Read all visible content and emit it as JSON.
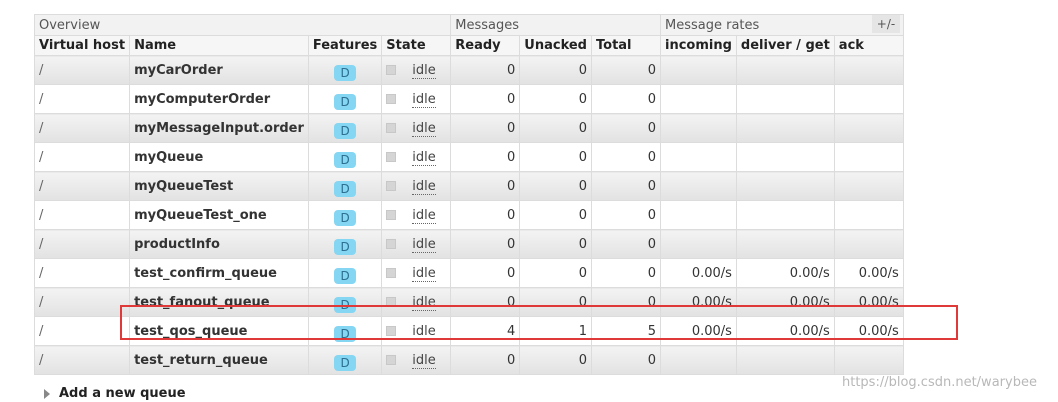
{
  "table": {
    "group_headers": {
      "overview": "Overview",
      "messages": "Messages",
      "message_rates": "Message rates"
    },
    "columns": [
      "Virtual host",
      "Name",
      "Features",
      "State",
      "Ready",
      "Unacked",
      "Total",
      "incoming",
      "deliver / get",
      "ack"
    ],
    "plus_minus": "+/-",
    "rows": [
      {
        "vhost": "/",
        "name": "myCarOrder",
        "feature": "D",
        "state": "idle",
        "ready": "0",
        "unacked": "0",
        "total": "0",
        "incoming": "",
        "deliver_get": "",
        "ack": ""
      },
      {
        "vhost": "/",
        "name": "myComputerOrder",
        "feature": "D",
        "state": "idle",
        "ready": "0",
        "unacked": "0",
        "total": "0",
        "incoming": "",
        "deliver_get": "",
        "ack": ""
      },
      {
        "vhost": "/",
        "name": "myMessageInput.order",
        "feature": "D",
        "state": "idle",
        "ready": "0",
        "unacked": "0",
        "total": "0",
        "incoming": "",
        "deliver_get": "",
        "ack": ""
      },
      {
        "vhost": "/",
        "name": "myQueue",
        "feature": "D",
        "state": "idle",
        "ready": "0",
        "unacked": "0",
        "total": "0",
        "incoming": "",
        "deliver_get": "",
        "ack": ""
      },
      {
        "vhost": "/",
        "name": "myQueueTest",
        "feature": "D",
        "state": "idle",
        "ready": "0",
        "unacked": "0",
        "total": "0",
        "incoming": "",
        "deliver_get": "",
        "ack": ""
      },
      {
        "vhost": "/",
        "name": "myQueueTest_one",
        "feature": "D",
        "state": "idle",
        "ready": "0",
        "unacked": "0",
        "total": "0",
        "incoming": "",
        "deliver_get": "",
        "ack": ""
      },
      {
        "vhost": "/",
        "name": "productInfo",
        "feature": "D",
        "state": "idle",
        "ready": "0",
        "unacked": "0",
        "total": "0",
        "incoming": "",
        "deliver_get": "",
        "ack": ""
      },
      {
        "vhost": "/",
        "name": "test_confirm_queue",
        "feature": "D",
        "state": "idle",
        "ready": "0",
        "unacked": "0",
        "total": "0",
        "incoming": "0.00/s",
        "deliver_get": "0.00/s",
        "ack": "0.00/s"
      },
      {
        "vhost": "/",
        "name": "test_fanout_queue",
        "feature": "D",
        "state": "idle",
        "ready": "0",
        "unacked": "0",
        "total": "0",
        "incoming": "0.00/s",
        "deliver_get": "0.00/s",
        "ack": "0.00/s"
      },
      {
        "vhost": "/",
        "name": "test_qos_queue",
        "feature": "D",
        "state": "idle",
        "ready": "4",
        "unacked": "1",
        "total": "5",
        "incoming": "0.00/s",
        "deliver_get": "0.00/s",
        "ack": "0.00/s"
      },
      {
        "vhost": "/",
        "name": "test_return_queue",
        "feature": "D",
        "state": "idle",
        "ready": "0",
        "unacked": "0",
        "total": "0",
        "incoming": "",
        "deliver_get": "",
        "ack": ""
      }
    ]
  },
  "add_queue_label": "Add a new queue",
  "watermark": "https://blog.csdn.net/warybee",
  "colors": {
    "badge": "#84d6f2",
    "highlight": "#e0393a"
  }
}
